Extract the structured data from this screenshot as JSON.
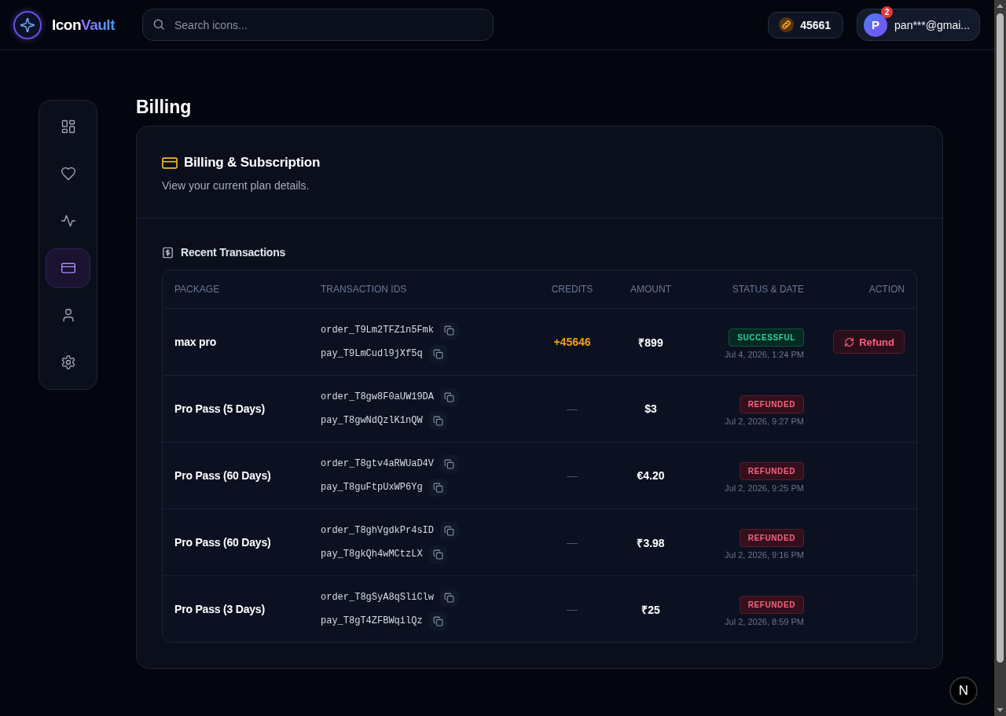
{
  "header": {
    "brand": {
      "name_part_1": "Icon",
      "name_part_2": "Vault"
    },
    "search": {
      "placeholder": "Search icons..."
    },
    "credits": "45661",
    "user": {
      "avatar_letter": "P",
      "notification_count": "2",
      "email": "pan***@gmai..."
    }
  },
  "sidebar": {
    "items": [
      {
        "selected": false
      },
      {
        "selected": false
      },
      {
        "selected": false
      },
      {
        "selected": true
      },
      {
        "selected": false
      },
      {
        "selected": false
      }
    ]
  },
  "page_title": "Billing",
  "billing_card": {
    "title": "Billing & Subscription",
    "subtitle": "View your current plan details.",
    "transactions": {
      "title": "Recent Transactions",
      "columns": [
        "PACKAGE",
        "TRANSACTION IDS",
        "CREDITS",
        "AMOUNT",
        "STATUS & DATE",
        "ACTION"
      ],
      "rows": [
        {
          "package": "max pro",
          "order_id": "order_T9Lm2TFZ1n5Fmk",
          "payment_id": "pay_T9LmCudl9jXf5q",
          "credits": {
            "text": "+45646",
            "kind": "added"
          },
          "amount": "₹899",
          "status": {
            "label": "SUCCESSFUL",
            "kind": "success"
          },
          "date": "Jul 4, 2026, 1:24 PM",
          "action": {
            "label": "Refund"
          }
        },
        {
          "package": "Pro Pass (5 Days)",
          "order_id": "order_T8gw8F0aUW19DA",
          "payment_id": "pay_T8gwNdQzlK1nQW",
          "credits": {
            "text": "—",
            "kind": "none"
          },
          "amount": "$3",
          "status": {
            "label": "REFUNDED",
            "kind": "refunded"
          },
          "date": "Jul 2, 2026, 9:27 PM"
        },
        {
          "package": "Pro Pass (60 Days)",
          "order_id": "order_T8gtv4aRWUaD4V",
          "payment_id": "pay_T8guFtpUxWP6Yg",
          "credits": {
            "text": "—",
            "kind": "none"
          },
          "amount": "€4.20",
          "status": {
            "label": "REFUNDED",
            "kind": "refunded"
          },
          "date": "Jul 2, 2026, 9:25 PM"
        },
        {
          "package": "Pro Pass (60 Days)",
          "order_id": "order_T8ghVgdkPr4sID",
          "payment_id": "pay_T8gkQh4wMCtzLX",
          "credits": {
            "text": "—",
            "kind": "none"
          },
          "amount": "₹3.98",
          "status": {
            "label": "REFUNDED",
            "kind": "refunded"
          },
          "date": "Jul 2, 2026, 9:16 PM"
        },
        {
          "package": "Pro Pass (3 Days)",
          "order_id": "order_T8gSyA8qSliClw",
          "payment_id": "pay_T8gT4ZFBWqilQz",
          "credits": {
            "text": "—",
            "kind": "none"
          },
          "amount": "₹25",
          "status": {
            "label": "REFUNDED",
            "kind": "refunded"
          },
          "date": "Jul 2, 2026, 8:59 PM"
        }
      ]
    }
  },
  "dev_badge": "N"
}
